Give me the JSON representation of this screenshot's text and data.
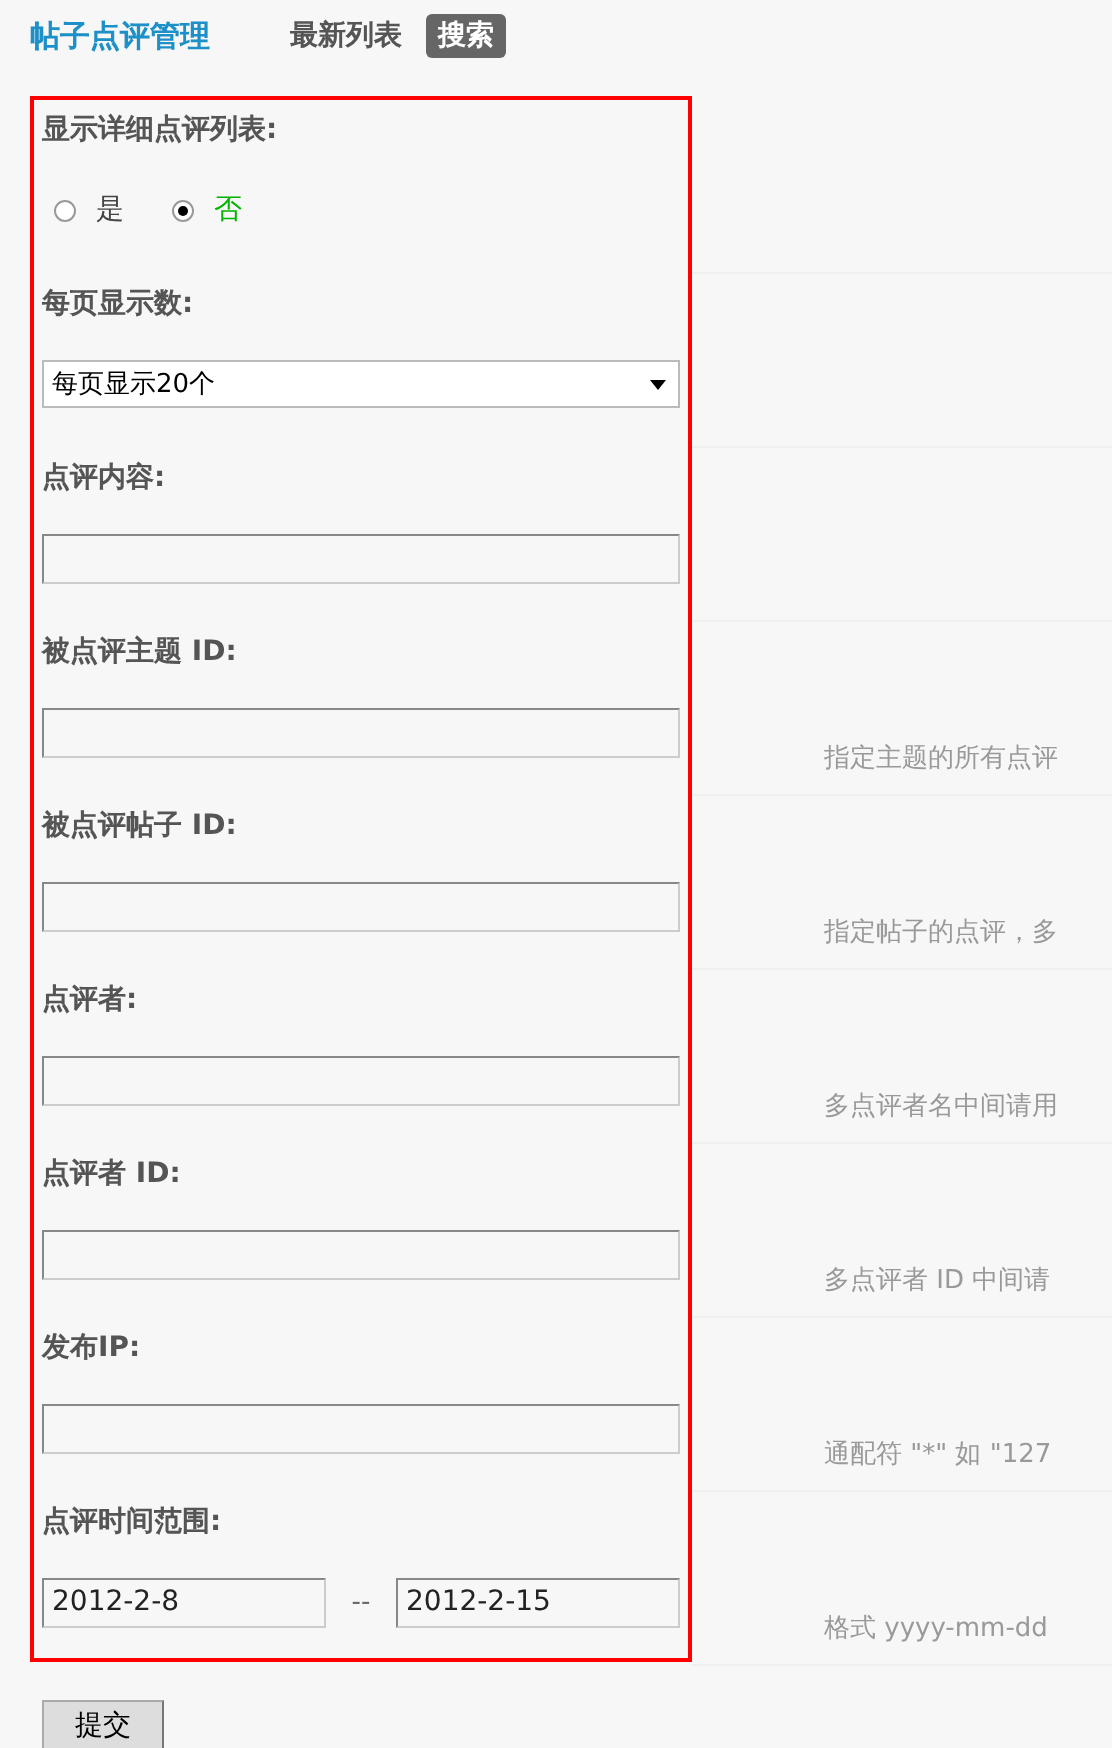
{
  "header": {
    "title": "帖子点评管理",
    "tabs": [
      {
        "label": "最新列表",
        "selected": false
      },
      {
        "label": "搜索",
        "selected": true
      }
    ]
  },
  "fields": [
    {
      "kind": "radio",
      "label": "显示详细点评列表:",
      "options": [
        {
          "label": "是",
          "selected": false
        },
        {
          "label": "否",
          "selected": true
        }
      ]
    },
    {
      "kind": "select",
      "label": "每页显示数:",
      "value": "每页显示20个"
    },
    {
      "kind": "text",
      "label": "点评内容:"
    },
    {
      "kind": "text",
      "label": "被点评主题 ID:",
      "hint": "指定主题的所有点评"
    },
    {
      "kind": "text",
      "label": "被点评帖子 ID:",
      "hint": "指定帖子的点评，多"
    },
    {
      "kind": "text",
      "label": "点评者:",
      "hint": "多点评者名中间请用"
    },
    {
      "kind": "text",
      "label": "点评者 ID:",
      "hint": "多点评者 ID 中间请"
    },
    {
      "kind": "text",
      "label": "发布IP:",
      "hint": "通配符 \"*\" 如 \"127"
    },
    {
      "kind": "daterange",
      "label": "点评时间范围:",
      "from": "2012-2-8",
      "separator": "--",
      "to": "2012-2-15",
      "hint": "格式 yyyy-mm-dd"
    }
  ],
  "submit": "提交"
}
